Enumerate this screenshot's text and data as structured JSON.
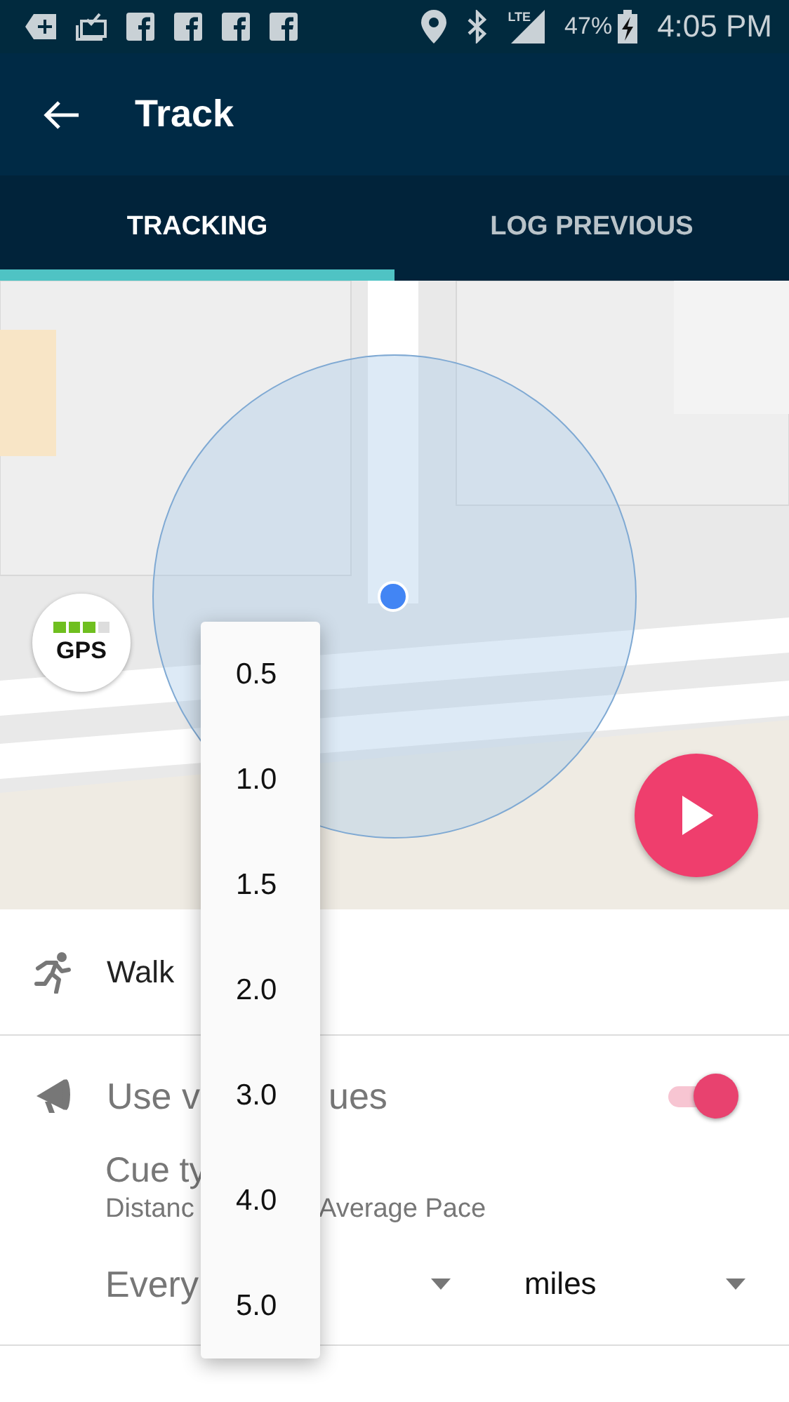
{
  "status_bar": {
    "network": "LTE",
    "battery": "47%",
    "time": "4:05 PM"
  },
  "app_bar": {
    "title": "Track"
  },
  "tabs": [
    {
      "label": "TRACKING",
      "selected": true
    },
    {
      "label": "LOG PREVIOUS",
      "selected": false
    }
  ],
  "map": {
    "kind": "picture",
    "gps_badge": {
      "label": "GPS",
      "level": 0.75
    }
  },
  "activity": {
    "label": "Walk"
  },
  "voice_cues": {
    "label_parts": [
      "Use v",
      "ues"
    ],
    "on": true,
    "cue_type": {
      "label": "Cue ty",
      "value_parts": [
        "Distanc",
        "Average Pace"
      ]
    },
    "every": {
      "label": "Every",
      "unit": "miles"
    }
  },
  "dropdown": {
    "options": [
      "0.5",
      "1.0",
      "1.5",
      "2.0",
      "3.0",
      "4.0",
      "5.0"
    ]
  }
}
